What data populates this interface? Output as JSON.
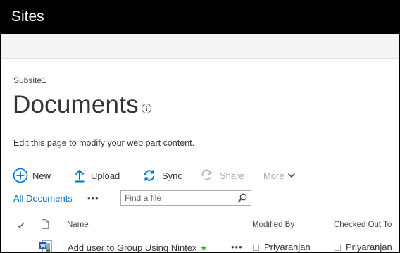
{
  "suite_bar": {
    "title": "Sites"
  },
  "breadcrumb": "Subsite1",
  "page": {
    "title": "Documents",
    "hint": "Edit this page to modify your web part content."
  },
  "commands": {
    "new": "New",
    "upload": "Upload",
    "sync": "Sync",
    "share": "Share",
    "more": "More"
  },
  "view": {
    "label": "All Documents",
    "menu": "•••",
    "search_placeholder": "Find a file"
  },
  "columns": {
    "name": "Name",
    "modified_by": "Modified By",
    "checked_out_to": "Checked Out To"
  },
  "rows": [
    {
      "name": "Add user to Group Using Nintex",
      "new_marker": "✱",
      "menu": "•••",
      "modified_by": "Priyaranjan",
      "checked_out_to": "Priyaranjan"
    }
  ],
  "colors": {
    "suite_bar": "#000000",
    "accent": "#0072c6",
    "new_marker": "#3a9b3a",
    "word_icon": "#2b579a"
  }
}
